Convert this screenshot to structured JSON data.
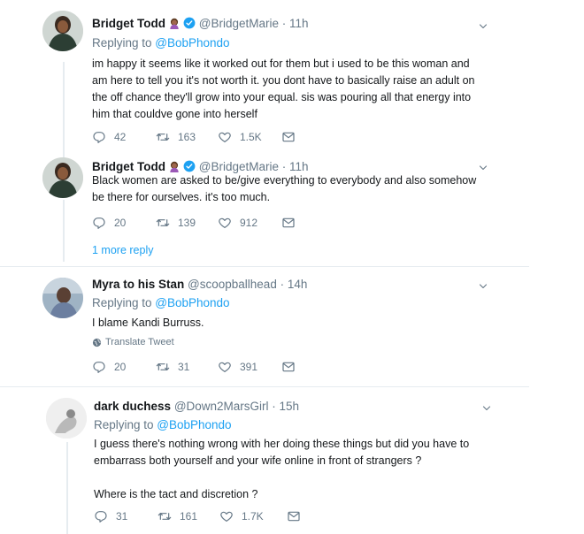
{
  "tweets": [
    {
      "name": "Bridget Todd",
      "handle": "@BridgetMarie · 11h",
      "replying_prefix": "Replying to ",
      "replying_to": "@BobPhondo",
      "text": "im happy it seems like it worked out for them but i used to be this woman and\nam here to tell you it's not worth it. you dont have to basically raise an adult on\nthe off chance they'll grow into your equal. sis was pouring all that energy into\nhim that couldve gone into herself",
      "replies": "42",
      "retweets": "163",
      "likes": "1.5K"
    },
    {
      "name": "Bridget Todd",
      "handle": "@BridgetMarie · 11h",
      "text": "Black women are asked to be/give everything to everybody and also somehow\nbe there for ourselves. it's too much.",
      "replies": "20",
      "retweets": "139",
      "likes": "912",
      "more_reply": "1 more reply"
    },
    {
      "name": "Myra to his Stan",
      "handle": "@scoopballhead · 14h",
      "replying_prefix": "Replying to ",
      "replying_to": "@BobPhondo",
      "text": "I blame Kandi Burruss.",
      "translate": "Translate Tweet",
      "replies": "20",
      "retweets": "31",
      "likes": "391"
    },
    {
      "name": "dark duchess",
      "handle": "@Down2MarsGirl · 15h",
      "replying_prefix": "Replying to ",
      "replying_to": "@BobPhondo",
      "text": "I guess there's nothing wrong with her doing these things but did you have to\nembarrass both yourself and your wife online in front of strangers ?\n\nWhere is the tact and discretion ?",
      "replies": "31",
      "retweets": "161",
      "likes": "1.7K"
    }
  ],
  "colors": {
    "link": "#1da1f2",
    "muted": "#657786",
    "text": "#14171a",
    "border": "#e6ecf0"
  },
  "icons": [
    "reply-icon",
    "retweet-icon",
    "like-icon",
    "dm-icon",
    "verified-icon",
    "chevron-down-icon",
    "globe-icon"
  ]
}
